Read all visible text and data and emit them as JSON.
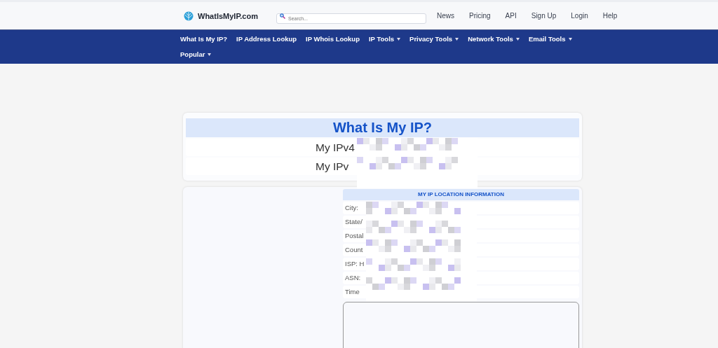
{
  "header": {
    "logo": "WhatIsMyIP.com",
    "search": {
      "placeholder": "Search..."
    },
    "links": [
      "News",
      "Pricing",
      "API",
      "Sign Up",
      "Login",
      "Help"
    ]
  },
  "nav": [
    {
      "label": "What Is My IP?",
      "dropdown": false
    },
    {
      "label": "IP Address Lookup",
      "dropdown": false
    },
    {
      "label": "IP Whois Lookup",
      "dropdown": false
    },
    {
      "label": "IP Tools",
      "dropdown": true
    },
    {
      "label": "Privacy Tools",
      "dropdown": true
    },
    {
      "label": "Network Tools",
      "dropdown": true
    },
    {
      "label": "Email Tools",
      "dropdown": true
    },
    {
      "label": "Popular",
      "dropdown": true
    }
  ],
  "ip_card": {
    "title": "What Is My IP?",
    "rows": [
      "My IPv4",
      "My IPv"
    ]
  },
  "location": {
    "title": "MY IP LOCATION INFORMATION",
    "rows": [
      "City:",
      "State/",
      "Postal",
      "Count",
      "ISP: H",
      "ASN:",
      "Time"
    ]
  }
}
